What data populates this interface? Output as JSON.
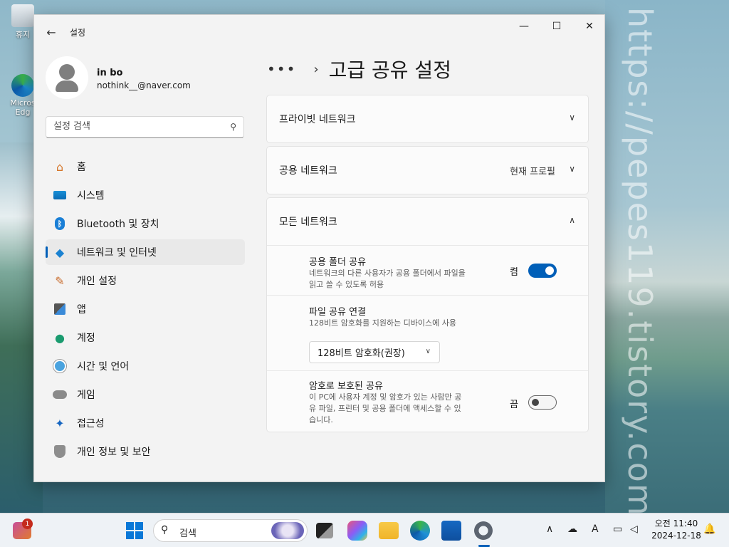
{
  "desktop": {
    "icons": [
      {
        "label": "휴지"
      },
      {
        "label": "Micros Edg"
      }
    ],
    "watermark": "https://pepes119.tistory.com/"
  },
  "window": {
    "app_title": "설정",
    "controls": {
      "minimize": "—",
      "maximize": "☐",
      "close": "✕"
    }
  },
  "profile": {
    "name": "in bo",
    "email": "nothink__@naver.com"
  },
  "search": {
    "placeholder": "설정 검색"
  },
  "sidebar": {
    "items": [
      {
        "label": "홈",
        "icon": "home-icon"
      },
      {
        "label": "시스템",
        "icon": "system-icon"
      },
      {
        "label": "Bluetooth 및 장치",
        "icon": "bluetooth-icon"
      },
      {
        "label": "네트워크 및 인터넷",
        "icon": "network-icon",
        "active": true
      },
      {
        "label": "개인 설정",
        "icon": "personalization-icon"
      },
      {
        "label": "앱",
        "icon": "apps-icon"
      },
      {
        "label": "계정",
        "icon": "account-icon"
      },
      {
        "label": "시간 및 언어",
        "icon": "time-language-icon"
      },
      {
        "label": "게임",
        "icon": "gaming-icon"
      },
      {
        "label": "접근성",
        "icon": "accessibility-icon"
      },
      {
        "label": "개인 정보 및 보안",
        "icon": "privacy-icon"
      }
    ]
  },
  "main": {
    "breadcrumb_more": "•••",
    "breadcrumb_sep": "›",
    "page_title": "고급 공유 설정",
    "private_network": {
      "label": "프라이빗 네트워크"
    },
    "public_network": {
      "label": "공용 네트워크",
      "extra": "현재 프로필"
    },
    "all_networks": {
      "label": "모든 네트워크",
      "public_folder": {
        "title": "공용 폴더 공유",
        "desc1": "네트워크의 다른 사용자가 공용 폴더에서 파일을",
        "desc2": "읽고 쓸 수 있도록 허용",
        "state_label": "켬",
        "on": true
      },
      "file_sharing": {
        "title": "파일 공유 연결",
        "desc": "128비트 암호화를 지원하는 디바이스에 사용",
        "selected": "128비트 암호화(권장)"
      },
      "password_sharing": {
        "title": "암호로 보호된 공유",
        "desc1": "이 PC에 사용자 계정 및 암호가 있는 사람만 공",
        "desc2": "유 파일, 프린터 및 공용 폴더에 액세스할 수 있",
        "desc3": "습니다.",
        "state_label": "끔",
        "on": false
      }
    }
  },
  "taskbar": {
    "badge": "1",
    "search_label": "검색",
    "clock_time": "오전 11:40",
    "clock_date": "2024-12-18"
  },
  "colors": {
    "accent": "#005fb8"
  }
}
